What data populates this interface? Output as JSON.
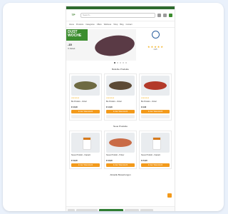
{
  "header": {
    "logo_text": "TP",
    "search_placeholder": "Search..."
  },
  "nav": {
    "items": [
      "Home",
      "Products",
      "Categories",
      "Offers",
      "Wellness",
      "Shop",
      "Blog",
      "Contact"
    ]
  },
  "hero": {
    "banner": "DUST\nWOCHE",
    "headline": "-15",
    "sub": "% Rabatt",
    "rating_text": "4.9/5",
    "stars": 5
  },
  "sections": [
    {
      "title": "Beliebte Produkte",
      "products": [
        {
          "title": "Bio Produkt – Vorteil",
          "price": "€ 12,90",
          "color": "#6e6a42",
          "cart": "In den Warenkorb"
        },
        {
          "title": "Bio Produkt – Vorteil",
          "price": "€ 14,90",
          "color": "#5c4a36",
          "cart": "In den Warenkorb"
        },
        {
          "title": "Bio Produkt – Vorteil",
          "price": "€ 9,90",
          "color": "#b33a2a",
          "cart": "In den Warenkorb"
        }
      ]
    },
    {
      "title": "Neue Produkte",
      "products": [
        {
          "title": "Neues Produkt – Kapseln",
          "price": "€ 19,90",
          "color": "#ffffff",
          "cart": "In den Warenkorb"
        },
        {
          "title": "Neues Produkt – Pulver",
          "price": "€ 16,90",
          "color": "#c96b46",
          "cart": "In den Warenkorb"
        },
        {
          "title": "Neues Produkt – Kapseln",
          "price": "€ 21,90",
          "color": "#ffffff",
          "cart": "In den Warenkorb"
        }
      ]
    }
  ],
  "reviews": {
    "title": "Aktuelle Bewertungen"
  }
}
